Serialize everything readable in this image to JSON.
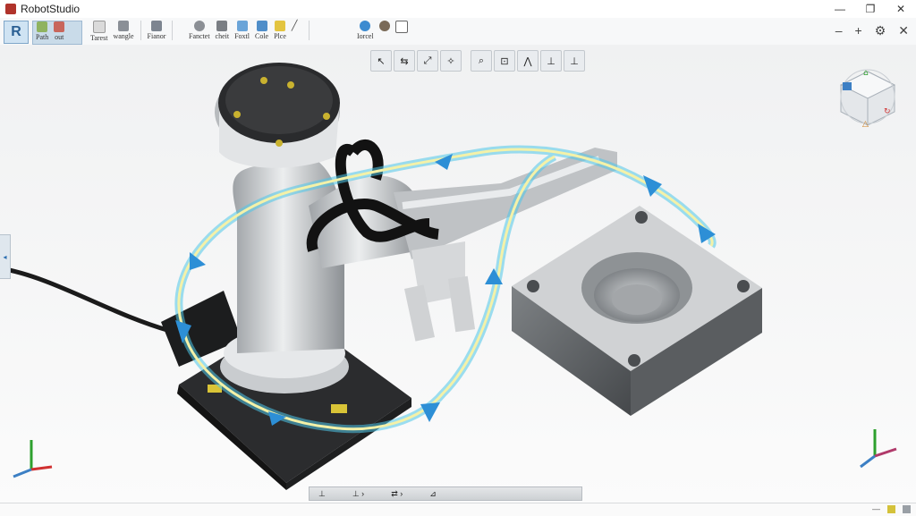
{
  "app": {
    "title": "RobotStudio"
  },
  "window_controls": {
    "minimize": "—",
    "restore": "❐",
    "close": "✕"
  },
  "ribbon": {
    "logo": "R",
    "groups": [
      {
        "items": [
          "Path",
          "out"
        ]
      },
      {
        "items": [
          "Tarest",
          "wangle",
          "Fianor"
        ]
      },
      {
        "items": [
          "Fanctet",
          "cheit",
          "Foxtl",
          "Cole",
          "Plce"
        ]
      },
      {
        "items": [
          "Iorcel"
        ]
      }
    ],
    "right_icons": [
      "–",
      "+",
      "⚙",
      "✕"
    ]
  },
  "view_toolbar": {
    "buttons": [
      "↖",
      "⇆",
      "⤢",
      "✧",
      "⌕",
      "⊡",
      "⋀",
      "⊥",
      "⊥"
    ]
  },
  "bottom_strip": {
    "items": [
      "⊥",
      "⊥ ›",
      "⇄ ›",
      "⊿"
    ]
  },
  "colors": {
    "accent": "#2a6db0",
    "path": "#f4f1a8",
    "glow": "#4fc6e8"
  }
}
